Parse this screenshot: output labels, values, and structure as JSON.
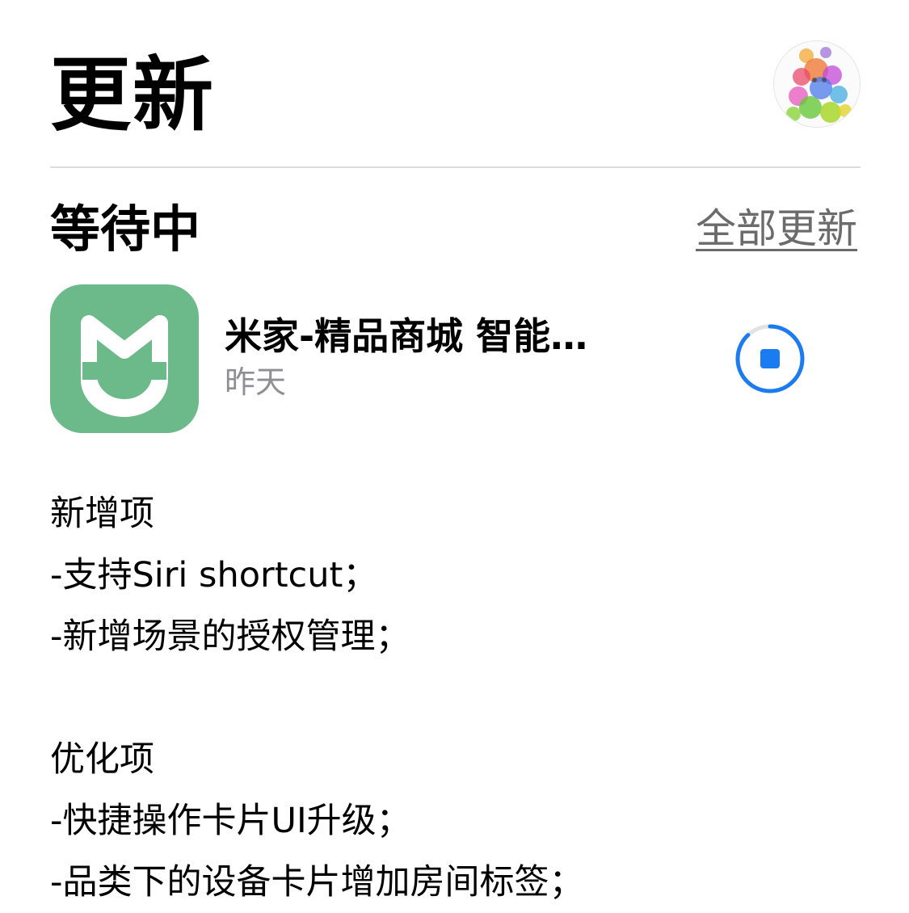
{
  "header": {
    "title": "更新",
    "avatar_icon": "user-avatar-colorful-portrait"
  },
  "pending": {
    "section_title": "等待中",
    "update_all_label": "全部更新"
  },
  "app": {
    "name": "米家-精品商城 智能…",
    "date": "昨天",
    "icon": "mijia-logo-icon",
    "icon_color": "#6cb98a",
    "download_state": "stop-download-icon",
    "progress_color": "#1a7cf0",
    "progress_fraction": 0.12
  },
  "release_notes": {
    "new_heading": "新增项",
    "new_items": [
      "-支持Siri shortcut；",
      "-新增场景的授权管理；"
    ],
    "improve_heading": "优化项",
    "improve_items": [
      "-快捷操作卡片UI升级；",
      "-品类下的设备卡片增加房间标签；"
    ]
  }
}
